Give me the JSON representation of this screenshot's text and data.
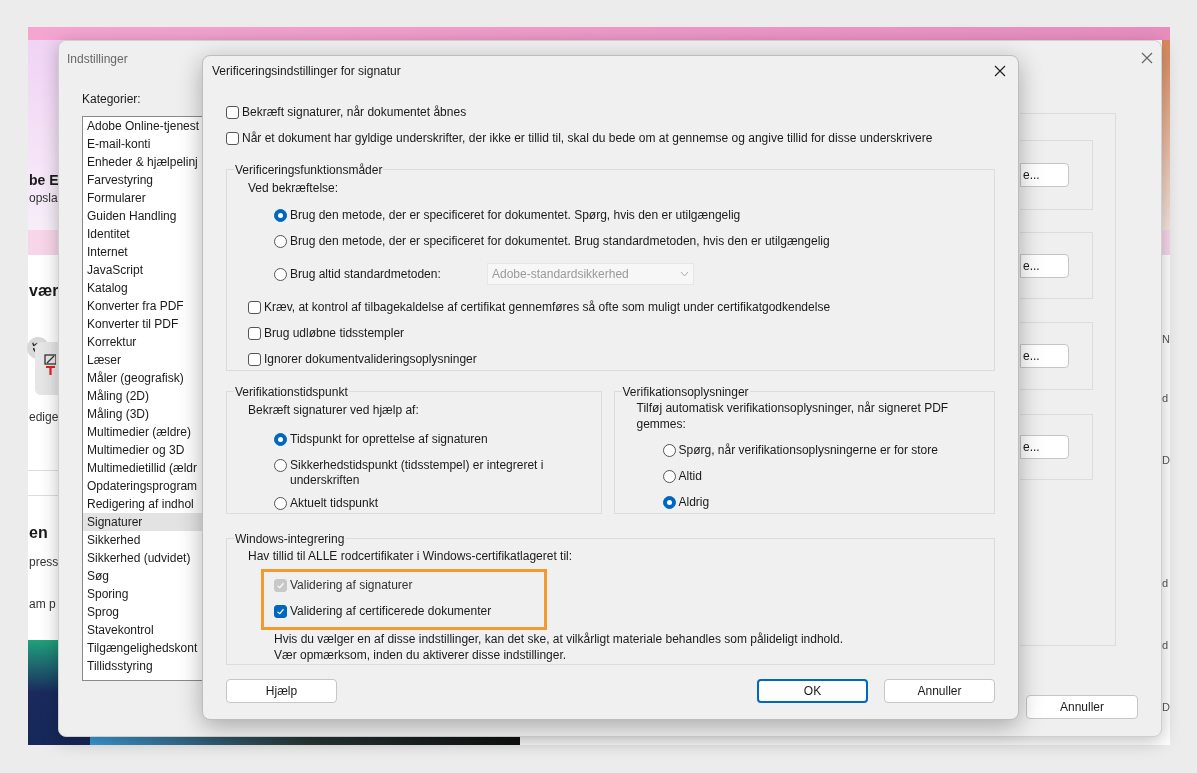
{
  "background_page": {
    "left_texts": [
      {
        "text": "be E",
        "kind": "heading"
      },
      {
        "text": "opsla",
        "kind": "body"
      },
      {
        "text": "vær",
        "kind": "heading"
      },
      {
        "text": "edige",
        "kind": "body"
      },
      {
        "text": "en",
        "kind": "heading"
      },
      {
        "text": "press",
        "kind": "body"
      },
      {
        "text": "am p",
        "kind": "body"
      }
    ],
    "right_texts": [
      "N",
      "d",
      "D",
      "d",
      "d",
      "D"
    ]
  },
  "settings_window": {
    "title": "Indstillinger",
    "categories_label": "Kategorier:",
    "categories": [
      {
        "label": "Adobe Online-tjenest",
        "selected": false
      },
      {
        "label": "E-mail-konti",
        "selected": false
      },
      {
        "label": "Enheder & hjælpelinj",
        "selected": false
      },
      {
        "label": "Farvestyring",
        "selected": false
      },
      {
        "label": "Formularer",
        "selected": false
      },
      {
        "label": "Guiden Handling",
        "selected": false
      },
      {
        "label": "Identitet",
        "selected": false
      },
      {
        "label": "Internet",
        "selected": false
      },
      {
        "label": "JavaScript",
        "selected": false
      },
      {
        "label": "Katalog",
        "selected": false
      },
      {
        "label": "Konverter fra PDF",
        "selected": false
      },
      {
        "label": "Konverter til PDF",
        "selected": false
      },
      {
        "label": "Korrektur",
        "selected": false
      },
      {
        "label": "Læser",
        "selected": false
      },
      {
        "label": "Måler (geografisk)",
        "selected": false
      },
      {
        "label": "Måling (2D)",
        "selected": false
      },
      {
        "label": "Måling (3D)",
        "selected": false
      },
      {
        "label": "Multimedier (ældre)",
        "selected": false
      },
      {
        "label": "Multimedier og 3D",
        "selected": false
      },
      {
        "label": "Multimedietillid (ældr",
        "selected": false
      },
      {
        "label": "Opdateringsprogram",
        "selected": false
      },
      {
        "label": "Redigering af indhol",
        "selected": false
      },
      {
        "label": "Signaturer",
        "selected": true
      },
      {
        "label": "Sikkerhed",
        "selected": false
      },
      {
        "label": "Sikkerhed (udvidet)",
        "selected": false
      },
      {
        "label": "Søg",
        "selected": false
      },
      {
        "label": "Sporing",
        "selected": false
      },
      {
        "label": "Sprog",
        "selected": false
      },
      {
        "label": "Stavekontrol",
        "selected": false
      },
      {
        "label": "Tilgængelighedskont",
        "selected": false
      },
      {
        "label": "Tillidsstyring",
        "selected": false
      }
    ],
    "side_buttons": [
      "e...",
      "e...",
      "e...",
      "e..."
    ],
    "cancel_button": "Annuller"
  },
  "dialog": {
    "title": "Verificeringsindstillinger for signatur",
    "options": [
      {
        "label": "Bekræft signaturer, når dokumentet åbnes",
        "checked": false
      },
      {
        "label": "Når et dokument har gyldige underskrifter, der ikke er tillid til, skal du bede om at gennemse og angive tillid for disse underskrivere",
        "checked": false
      }
    ],
    "verification_methods": {
      "legend": "Verificeringsfunktionsmåder",
      "prompt": "Ved bekræftelse:",
      "methods": [
        {
          "label": "Brug den metode, der er specificeret for dokumentet. Spørg, hvis den er utilgængelig",
          "selected": true
        },
        {
          "label": "Brug den metode, der er specificeret for dokumentet. Brug standardmetoden, hvis den er utilgængelig",
          "selected": false
        },
        {
          "label": "Brug altid standardmetoden:",
          "selected": false,
          "dropdown": {
            "value": "Adobe-standardsikkerhed",
            "disabled": true
          }
        }
      ],
      "options": [
        {
          "label": "Kræv, at kontrol af tilbagekaldelse af certifikat gennemføres så ofte som muligt under certifikatgodkendelse",
          "checked": false
        },
        {
          "label": "Brug udløbne tidsstempler",
          "checked": false
        },
        {
          "label": "Ignorer dokumentvalideringsoplysninger",
          "checked": false
        }
      ]
    },
    "verification_time": {
      "legend": "Verifikationstidspunkt",
      "prompt": "Bekræft signaturer ved hjælp af:",
      "choices": [
        {
          "label": "Tidspunkt for oprettelse af signaturen",
          "selected": true
        },
        {
          "label": "Sikkerhedstidspunkt (tidsstempel) er integreret i underskriften",
          "selected": false
        },
        {
          "label": "Aktuelt tidspunkt",
          "selected": false
        }
      ]
    },
    "verification_info": {
      "legend": "Verifikationsoplysninger",
      "prompt": "Tilføj automatisk verifikationsoplysninger, når signeret PDF gemmes:",
      "choices": [
        {
          "label": "Spørg, når verifikationsoplysningerne er for store",
          "selected": false
        },
        {
          "label": "Altid",
          "selected": false
        },
        {
          "label": "Aldrig",
          "selected": true
        }
      ]
    },
    "windows_integration": {
      "legend": "Windows-integrering",
      "prompt": "Hav tillid til ALLE rodcertifikater i Windows-certifikatlageret til:",
      "highlighted": true,
      "options": [
        {
          "label": "Validering af signaturer",
          "checked": true,
          "disabled": true
        },
        {
          "label": "Validering af certificerede dokumenter",
          "checked": true,
          "disabled": false
        }
      ],
      "note_lines": [
        "Hvis du vælger en af disse indstillinger, kan det ske, at vilkårligt materiale behandles som pålideligt indhold.",
        "Vær opmærksom, inden du aktiverer disse indstillinger."
      ]
    },
    "buttons": [
      {
        "label": "Hjælp",
        "kind": "help",
        "default": false
      },
      {
        "label": "OK",
        "kind": "ok",
        "default": true
      },
      {
        "label": "Annuller",
        "kind": "cancel",
        "default": false
      }
    ]
  }
}
